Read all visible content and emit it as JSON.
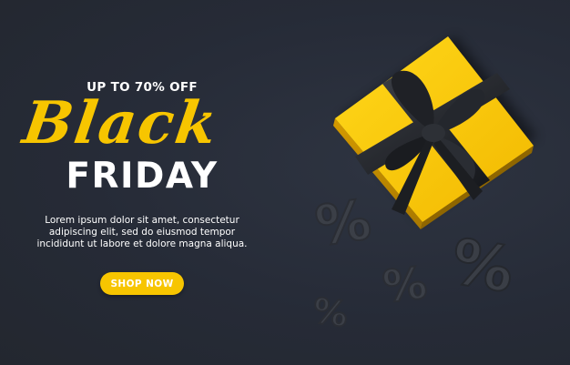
{
  "banner": {
    "offer_text": "UP TO 70% OFF",
    "headline_script": "Black",
    "headline_bold": "FRIDAY",
    "body_lines": [
      "Lorem ipsum dolor sit amet, consectetur",
      "adipiscing elit, sed do eiusmod tempor",
      "incididunt ut labore et dolore magna aliqua."
    ],
    "cta_label": "SHOP NOW",
    "percent_symbol": "%"
  },
  "colors": {
    "background": "#262b37",
    "accent_yellow": "#f7c500",
    "text_white": "#ffffff",
    "ribbon_black": "#1c1e22",
    "percent_dark": "#3b3f47"
  },
  "icons": [
    "gift-box-icon",
    "percent-icon"
  ]
}
